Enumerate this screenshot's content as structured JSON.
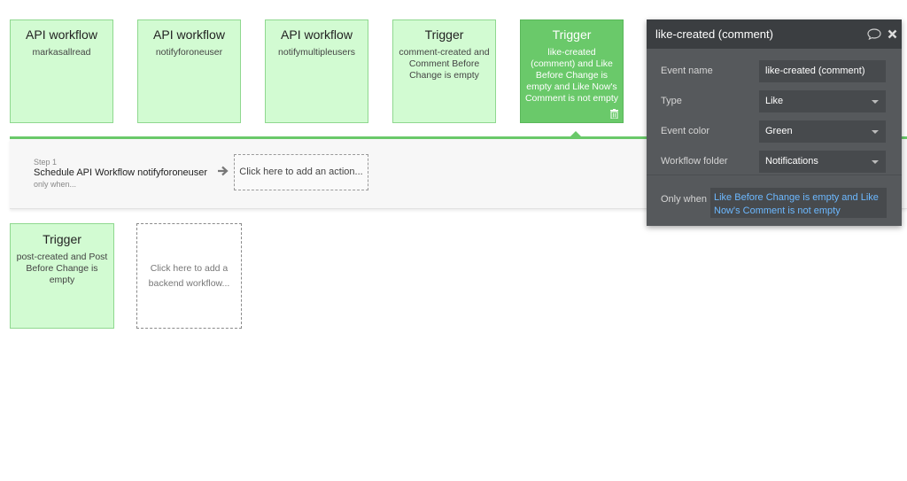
{
  "cards": [
    {
      "title": "API workflow",
      "subtitle": "markasallread"
    },
    {
      "title": "API workflow",
      "subtitle": "notifyforoneuser"
    },
    {
      "title": "API workflow",
      "subtitle": "notifymultipleusers"
    },
    {
      "title": "Trigger",
      "subtitle": "comment-created and Comment Before Change is empty"
    },
    {
      "title": "Trigger",
      "subtitle": "like-created (comment) and Like Before Change is empty and Like Now's Comment is not empty"
    }
  ],
  "step": {
    "number": "Step 1",
    "title": "Schedule API Workflow notifyforoneuser",
    "only_when": "only when...",
    "add_action": "Click here to add an action..."
  },
  "trigger_bottom": {
    "title": "Trigger",
    "subtitle": "post-created and Post Before Change is empty"
  },
  "add_backend": "Click here to add a backend workflow...",
  "panel": {
    "title": "like-created (comment)",
    "event_name_label": "Event name",
    "event_name_value": "like-created (comment)",
    "type_label": "Type",
    "type_value": "Like",
    "color_label": "Event color",
    "color_value": "Green",
    "folder_label": "Workflow folder",
    "folder_value": "Notifications",
    "only_when_label": "Only when",
    "only_when_value": "Like Before Change is empty and Like Now's Comment is not empty"
  },
  "colors": {
    "card_bg": "#d2fbd2",
    "selected_bg": "#6ac96a",
    "panel_bg": "#56595c",
    "link": "#6cb8ff"
  }
}
